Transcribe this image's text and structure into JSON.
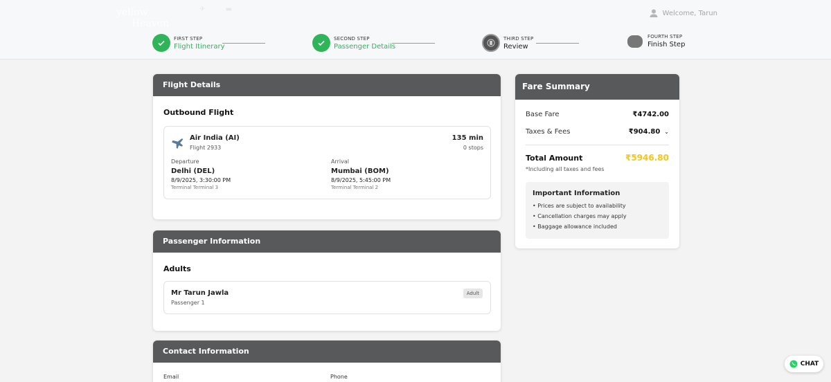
{
  "header": {
    "logo_line1": "yellow",
    "logo_line2": "Heaven",
    "welcome": "Welcome, Tarun"
  },
  "steps": [
    {
      "small": "FIRST STEP",
      "label": "Flight Itinerary",
      "state": "done"
    },
    {
      "small": "SECOND STEP",
      "label": "Passenger Details",
      "state": "done"
    },
    {
      "small": "THIRD STEP",
      "label": "Review",
      "state": "current"
    },
    {
      "small": "FOURTH STEP",
      "label": "Finish Step",
      "state": "todo"
    }
  ],
  "flight_details": {
    "heading": "Flight Details",
    "section": "Outbound Flight",
    "airline": "Air India (AI)",
    "flight_no": "Flight 2933",
    "duration": "135 min",
    "stops": "0 stops",
    "departure": {
      "label": "Departure",
      "city": "Delhi (DEL)",
      "time": "8/9/2025, 3:30:00 PM",
      "terminal": "Terminal Terminal 3"
    },
    "arrival": {
      "label": "Arrival",
      "city": "Mumbai (BOM)",
      "time": "8/9/2025, 5:45:00 PM",
      "terminal": "Terminal Terminal 2"
    }
  },
  "passenger_info": {
    "heading": "Passenger Information",
    "section": "Adults",
    "name": "Mr Tarun Jawla",
    "sub": "Passenger 1",
    "badge": "Adult"
  },
  "contact_info": {
    "heading": "Contact Information",
    "email_label": "Email",
    "phone_label": "Phone"
  },
  "fare_summary": {
    "heading": "Fare Summary",
    "base_label": "Base Fare",
    "base_value": "₹4742.00",
    "taxes_label": "Taxes & Fees",
    "taxes_value": "₹904.80",
    "total_label": "Total Amount",
    "total_value": "₹5946.80",
    "note": "*Including all taxes and fees",
    "info_title": "Important Information",
    "info_items": [
      "• Prices are subject to availability",
      "• Cancellation charges may apply",
      "• Baggage allowance included"
    ]
  },
  "chat": {
    "label": "CHAT"
  },
  "colors": {
    "accent_green": "#2fb45a",
    "header_gray": "#58595b",
    "total_yellow": "#f5c518"
  }
}
